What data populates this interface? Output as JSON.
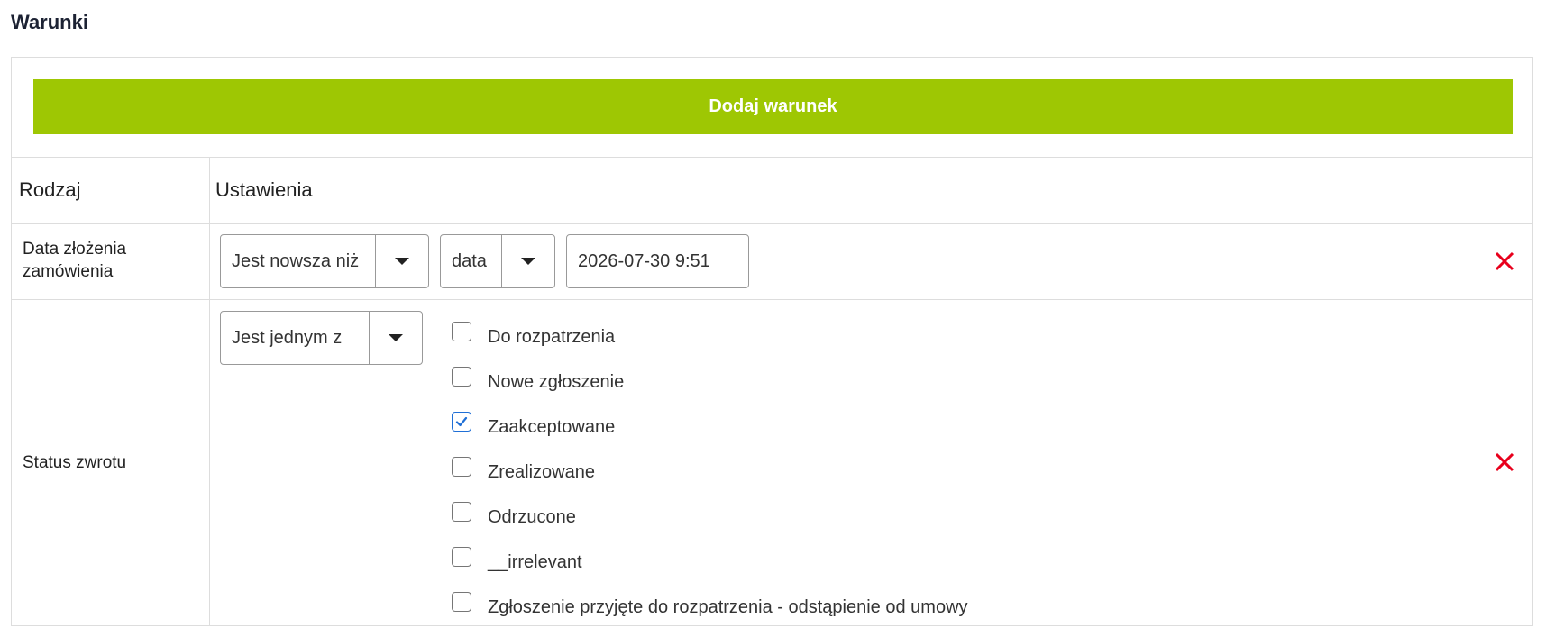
{
  "section_title": "Warunki",
  "add_button_label": "Dodaj warunek",
  "table": {
    "headers": {
      "type": "Rodzaj",
      "settings": "Ustawienia"
    },
    "rows": [
      {
        "type_label": "Data złożenia zamówienia",
        "operator": "Jest nowsza niż",
        "value_type": "data",
        "date_value": "2026-07-30 9:51"
      },
      {
        "type_label": "Status zwrotu",
        "operator": "Jest jednym z",
        "options": [
          {
            "label": "Do rozpatrzenia",
            "checked": false
          },
          {
            "label": "Nowe zgłoszenie",
            "checked": false
          },
          {
            "label": "Zaakceptowane",
            "checked": true
          },
          {
            "label": "Zrealizowane",
            "checked": false
          },
          {
            "label": "Odrzucone",
            "checked": false
          },
          {
            "label": "__irrelevant",
            "checked": false
          },
          {
            "label": "Zgłoszenie przyjęte do rozpatrzenia - odstąpienie od umowy",
            "checked": false
          }
        ]
      }
    ]
  },
  "icons": {
    "remove": "close-icon",
    "dropdown": "caret-down-icon",
    "check": "check-icon"
  },
  "colors": {
    "add_button": "#9ec703",
    "remove_icon": "#e8001c",
    "checkbox_checked": "#1f6fd6",
    "title": "#1c2233"
  }
}
